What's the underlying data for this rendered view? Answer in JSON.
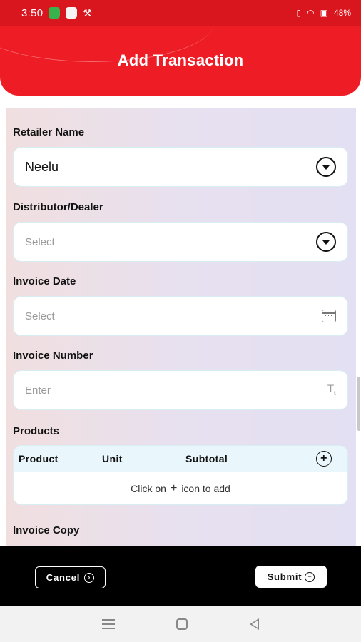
{
  "status_bar": {
    "time": "3:50",
    "battery": "48%"
  },
  "header": {
    "title": "Add Transaction"
  },
  "form": {
    "retailer": {
      "label": "Retailer Name",
      "value": "Neelu"
    },
    "distributor": {
      "label": "Distributor/Dealer",
      "placeholder": "Select"
    },
    "invoice_date": {
      "label": "Invoice Date",
      "placeholder": "Select"
    },
    "invoice_number": {
      "label": "Invoice Number",
      "placeholder": "Enter"
    },
    "products": {
      "label": "Products",
      "columns": [
        "Product",
        "Unit",
        "Subtotal"
      ],
      "empty_prefix": "Click on",
      "empty_suffix": "icon to add"
    },
    "invoice_copy": {
      "label": "Invoice Copy"
    }
  },
  "actions": {
    "cancel_label": "Cancel",
    "submit_label": "Submit"
  },
  "colors": {
    "header": "#ee1c25",
    "status_bar": "#d9151d",
    "bottom_bar": "#000000"
  },
  "icons": [
    "chevron-down-icon",
    "calendar-icon",
    "text-type-icon",
    "add-circle-icon",
    "plus-icon"
  ]
}
